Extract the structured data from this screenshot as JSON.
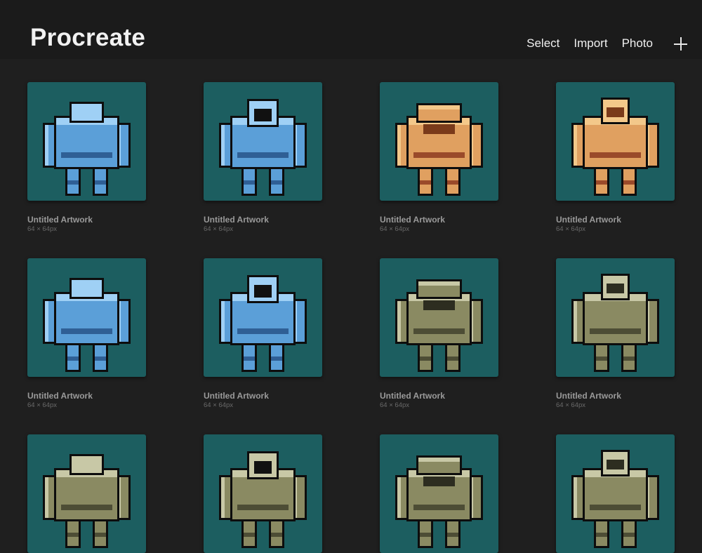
{
  "header": {
    "title": "Procreate",
    "actions": {
      "select": "Select",
      "import": "Import",
      "photo": "Photo"
    },
    "new_icon": "plus-icon"
  },
  "artworks": [
    {
      "title": "Untitled Artwork",
      "size": "64 × 64px",
      "sprite": "blue-horned-robot",
      "palette": "blue"
    },
    {
      "title": "Untitled Artwork",
      "size": "64 × 64px",
      "sprite": "blue-robot-pilot",
      "palette": "blue"
    },
    {
      "title": "Untitled Artwork",
      "size": "64 × 64px",
      "sprite": "orange-robot-back",
      "palette": "orange"
    },
    {
      "title": "Untitled Artwork",
      "size": "64 × 64px",
      "sprite": "orange-robot-front",
      "palette": "orange"
    },
    {
      "title": "Untitled Artwork",
      "size": "64 × 64px",
      "sprite": "blue-robot-back",
      "palette": "blue"
    },
    {
      "title": "Untitled Artwork",
      "size": "64 × 64px",
      "sprite": "blue-robot-front",
      "palette": "blue"
    },
    {
      "title": "Untitled Artwork",
      "size": "64 × 64px",
      "sprite": "olive-robot-back",
      "palette": "olive"
    },
    {
      "title": "Untitled Artwork",
      "size": "64 × 64px",
      "sprite": "olive-robot-front",
      "palette": "olive"
    },
    {
      "title": "",
      "size": "",
      "sprite": "olive-block-robot",
      "palette": "olive"
    },
    {
      "title": "",
      "size": "",
      "sprite": "olive-block-robot-2",
      "palette": "olive"
    },
    {
      "title": "",
      "size": "",
      "sprite": "olive-spider-robot",
      "palette": "olive"
    },
    {
      "title": "",
      "size": "",
      "sprite": "olive-box-robot",
      "palette": "olive"
    }
  ],
  "colors": {
    "background": "#1f1f1f",
    "thumbnail_bg": "#1c5e60",
    "blue_body": "#5b9fd8",
    "orange_body": "#e0a060",
    "olive_body": "#8a8a62"
  }
}
